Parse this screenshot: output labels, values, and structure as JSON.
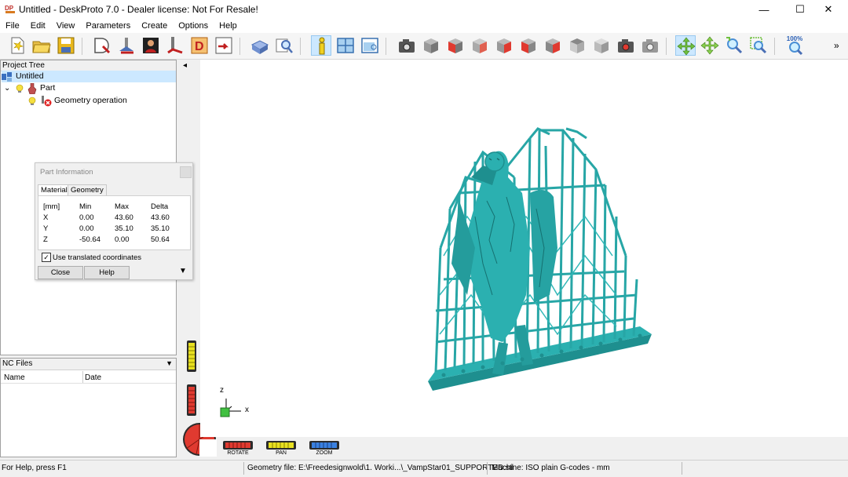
{
  "window": {
    "title": "Untitled - DeskProto 7.0 - Dealer license: Not For Resale!",
    "minimize": "—",
    "maximize": "☐",
    "close": "✕"
  },
  "menu": [
    "File",
    "Edit",
    "View",
    "Parameters",
    "Create",
    "Options",
    "Help"
  ],
  "project_tree": {
    "header": "Project Tree",
    "items": [
      {
        "label": "Untitled",
        "toggle": ""
      },
      {
        "label": "Part",
        "toggle": "⌄"
      },
      {
        "label": "Geometry operation",
        "toggle": ""
      }
    ]
  },
  "nc_files": {
    "header": "NC Files",
    "columns": [
      "Name",
      "Date"
    ]
  },
  "part_info": {
    "title": "Part Information",
    "tabs": [
      "Material",
      "Geometry"
    ],
    "header": [
      "[mm]",
      "Min",
      "Max",
      "Delta"
    ],
    "rows": [
      [
        "X",
        "0.00",
        "43.60",
        "43.60"
      ],
      [
        "Y",
        "0.00",
        "35.10",
        "35.10"
      ],
      [
        "Z",
        "-50.64",
        "0.00",
        "50.64"
      ]
    ],
    "checkbox_label": "Use translated coordinates",
    "checkbox_mark": "✓",
    "close_label": "Close",
    "help_label": "Help",
    "more_glyph": "▼"
  },
  "axes": {
    "z": "z",
    "x": "x"
  },
  "controls": {
    "rotate": "ROTATE",
    "pan": "PAN",
    "zoom": "ZOOM"
  },
  "toolbar": {
    "zoom_label": "100%",
    "overflow": "»",
    "collapse": "◂"
  },
  "status": {
    "help": "For Help, press F1",
    "geometry": "Geometry file: E:\\Freedesignwold\\1. Worki...\\_VampStar01_SUPPORTED.stl",
    "machine": "Machine: ISO plain G-codes - mm"
  },
  "colors": {
    "model": "#2bb0b0",
    "accent": "#cce8ff"
  }
}
